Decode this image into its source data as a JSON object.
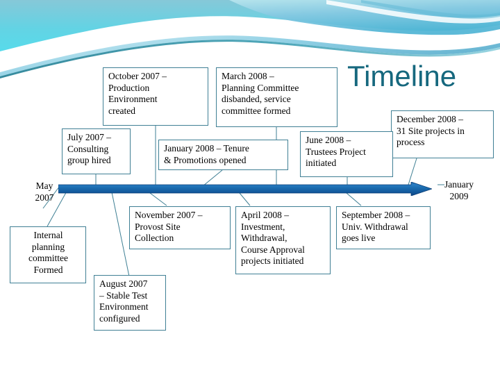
{
  "slide": {
    "title": "Timeline",
    "title_color": "#16687e",
    "background_color": "#ffffff",
    "box_border_color": "#3f7f94",
    "arrow_color": "#1f6fb5",
    "arrow_dark_color": "#0d4d8c",
    "header_colors": {
      "teal_light": "#8fd3de",
      "cyan": "#5fd6e6",
      "blue": "#7ec6e0",
      "steel": "#4ea6c8",
      "white": "#ffffff"
    }
  },
  "timeline": {
    "start_label": "May\n2007",
    "end_label": "January\n2009",
    "events": [
      {
        "id": "october-2007",
        "text": "October 2007 –\nProduction\nEnvironment\ncreated"
      },
      {
        "id": "march-2008",
        "text": "March 2008 –\nPlanning Committee\ndisbanded, service\ncommittee formed"
      },
      {
        "id": "december-2008",
        "text": "December 2008 –\n31 Site projects  in\nprocess"
      },
      {
        "id": "july-2007",
        "text": "July 2007 –\nConsulting\ngroup hired"
      },
      {
        "id": "january-2008",
        "text": "January 2008 – Tenure\n& Promotions  opened"
      },
      {
        "id": "june-2008",
        "text": "June 2008 –\nTrustees Project\ninitiated"
      },
      {
        "id": "internal-planning",
        "text": "Internal\nplanning\ncommittee\nFormed"
      },
      {
        "id": "november-2007",
        "text": "November 2007 –\nProvost Site\nCollection"
      },
      {
        "id": "april-2008",
        "text": "April 2008 –\nInvestment,\nWithdrawal,\nCourse Approval\nprojects initiated"
      },
      {
        "id": "september-2008",
        "text": "September 2008 –\nUniv. Withdrawal\ngoes live"
      },
      {
        "id": "august-2007",
        "text": "August 2007\n– Stable Test\nEnvironment\nconfigured"
      }
    ]
  }
}
